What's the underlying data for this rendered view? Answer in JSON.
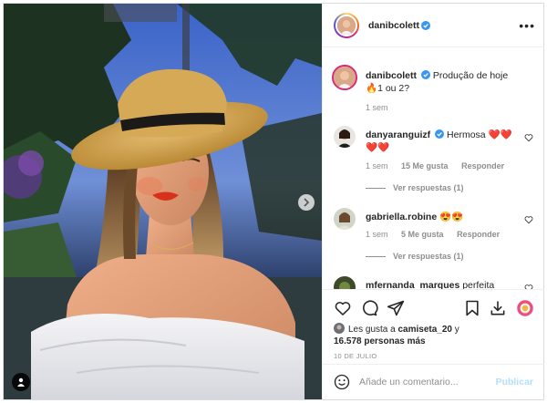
{
  "post": {
    "author": "danibcolett",
    "caption_user": "danibcolett",
    "caption_text": "Produção de hoje 🔥1 ou 2?",
    "caption_time": "1 sem",
    "more_label": "•••"
  },
  "comments": [
    {
      "user": "danyaranguizf",
      "text": "Hermosa ❤️❤️❤️❤️",
      "time": "1 sem",
      "likes": "15 Me gusta",
      "reply": "Responder",
      "view_replies": "Ver respuestas (1)"
    },
    {
      "user": "gabriella.robine",
      "text": "😍😍",
      "time": "1 sem",
      "likes": "5 Me gusta",
      "reply": "Responder",
      "view_replies": "Ver respuestas (1)"
    },
    {
      "user": "mfernanda_marques",
      "text": "perfeita"
    }
  ],
  "likes": {
    "prefix": "Les gusta a ",
    "first_user": "camiseta_20",
    "connector": " y",
    "others": "16.578 personas más"
  },
  "date": "10 DE JULIO",
  "add_comment": {
    "placeholder": "Añade un comentario...",
    "publish": "Publicar"
  },
  "icons": {
    "verified": "verified-badge-icon",
    "like": "heart-icon",
    "comment": "comment-bubble-icon",
    "share": "paper-plane-icon",
    "save": "bookmark-icon",
    "download": "download-icon",
    "emoji": "smiley-icon",
    "next": "chevron-right-icon",
    "tags": "person-tag-icon"
  },
  "colors": {
    "text": "#262626",
    "secondary": "#8e8e8e",
    "verified": "#3897f0",
    "publish_disabled": "#b2dffc",
    "border": "#dbdbdb"
  }
}
